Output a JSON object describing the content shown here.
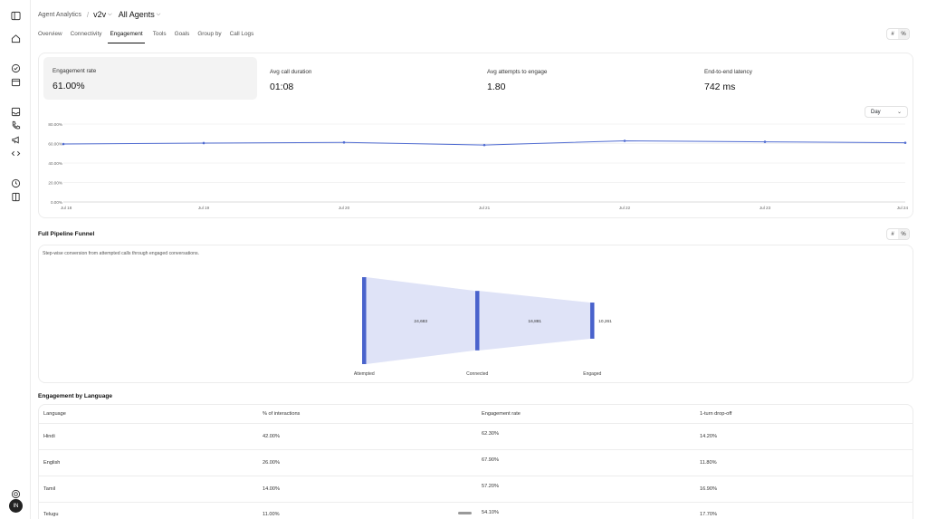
{
  "header": {
    "breadcrumb_root": "Agent Analytics",
    "separator": "/",
    "version": "v2v",
    "agent_selector": "All Agents"
  },
  "tabs": [
    {
      "label": "Overview"
    },
    {
      "label": "Connectivity"
    },
    {
      "label": "Engagement",
      "active": true
    },
    {
      "label": "Tools"
    },
    {
      "label": "Goals"
    },
    {
      "label": "Group by"
    },
    {
      "label": "Call Logs"
    }
  ],
  "toggle": {
    "count_label": "#",
    "percent_label": "%"
  },
  "stats": [
    {
      "label": "Engagement rate",
      "value": "61.00%",
      "selected": true
    },
    {
      "label": "Avg call duration",
      "value": "01:08"
    },
    {
      "label": "Avg attempts to engage",
      "value": "1.80"
    },
    {
      "label": "End-to-end latency",
      "value": "742 ms"
    }
  ],
  "granularity": {
    "value": "Day"
  },
  "chart_data": {
    "type": "line",
    "x": [
      "Jul 18",
      "Jul 19",
      "Jul 20",
      "Jul 21",
      "Jul 22",
      "Jul 23",
      "Jul 24"
    ],
    "series": [
      {
        "values": [
          59.5,
          60.5,
          61.2,
          58.5,
          62.8,
          61.8,
          60.8
        ]
      }
    ],
    "yticks": [
      "0.00%",
      "20.00%",
      "40.00%",
      "60.00%",
      "80.00%"
    ],
    "ylim": [
      0,
      80
    ],
    "grid": true,
    "color": "#4f6bd1"
  },
  "funnel": {
    "title": "Full Pipeline Funnel",
    "subtitle": "Step-wise conversion from attempted calls through engaged conversations.",
    "stages": [
      {
        "label": "Attempted",
        "value": 24683
      },
      {
        "label": "Connected",
        "value": 16881
      },
      {
        "label": "Engaged",
        "value": 10261
      }
    ],
    "between_labels": [
      "24,683",
      "16,881",
      "10,261"
    ],
    "bar_color": "#4a63cc",
    "fill_color": "#dfe3f7"
  },
  "language_table": {
    "title": "Engagement by Language",
    "columns": [
      "Language",
      "% of interactions",
      "Engagement rate",
      "1-turn drop-off"
    ],
    "rows": [
      [
        "Hindi",
        "42.00%",
        "62.30%",
        "14.20%"
      ],
      [
        "English",
        "26.00%",
        "67.90%",
        "11.80%"
      ],
      [
        "Tamil",
        "14.00%",
        "57.20%",
        "16.90%"
      ],
      [
        "Telugu",
        "11.00%",
        "54.10%",
        "17.70%"
      ]
    ]
  },
  "user": {
    "initials": "IN"
  },
  "icons": [
    "panel-toggle-icon",
    "home-icon",
    "check-circle-icon",
    "calendar-icon",
    "inbox-icon",
    "phone-icon",
    "megaphone-icon",
    "code-icon",
    "clock-icon",
    "book-icon",
    "settings-icon"
  ]
}
